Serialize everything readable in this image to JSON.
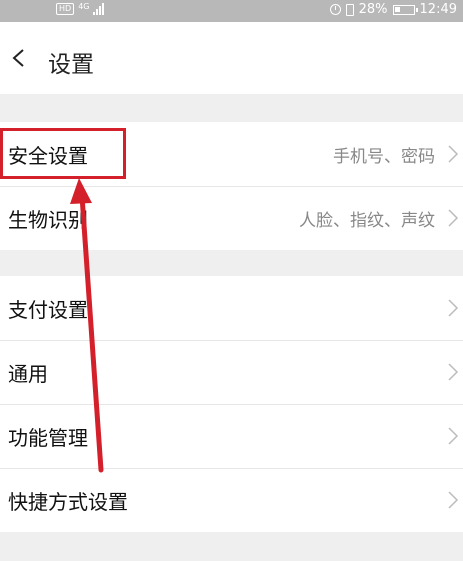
{
  "status_bar": {
    "hd": "HD",
    "network": "4G",
    "battery_pct": "28%",
    "time": "12:49"
  },
  "header": {
    "title": "设置"
  },
  "groups": [
    {
      "items": [
        {
          "label": "安全设置",
          "value": "手机号、密码"
        },
        {
          "label": "生物识别",
          "value": "人脸、指纹、声纹"
        }
      ]
    },
    {
      "items": [
        {
          "label": "支付设置",
          "value": ""
        },
        {
          "label": "通用",
          "value": ""
        },
        {
          "label": "功能管理",
          "value": ""
        },
        {
          "label": "快捷方式设置",
          "value": ""
        }
      ]
    }
  ],
  "annotation": {
    "highlight_color": "#d4202a",
    "highlighted_item": "安全设置"
  }
}
